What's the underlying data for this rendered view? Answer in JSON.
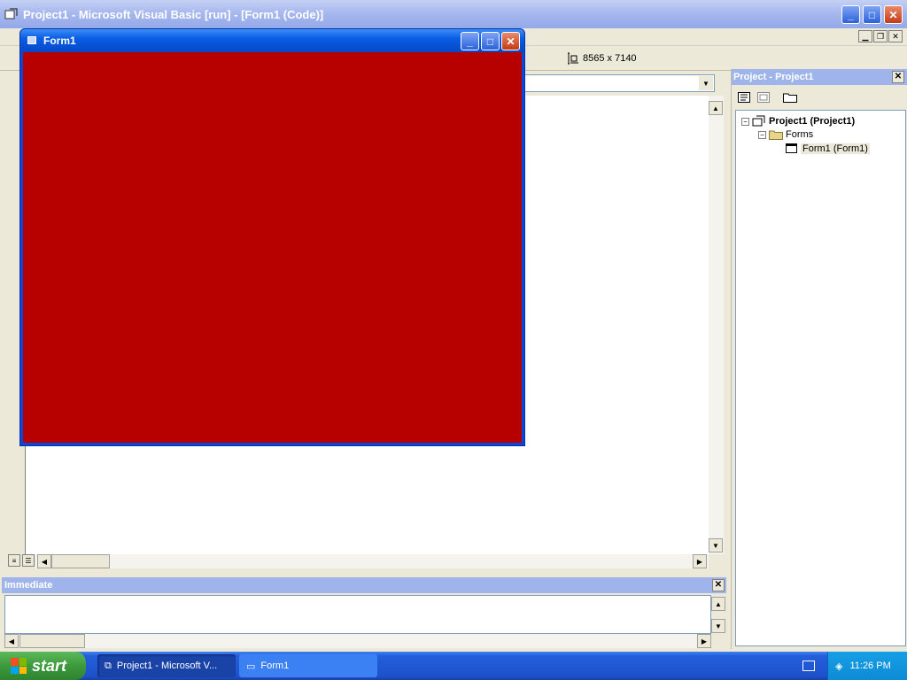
{
  "main_window": {
    "title": "Project1 - Microsoft Visual Basic [run] - [Form1 (Code)]",
    "minimize": "_",
    "maximize": "□",
    "close": "✕"
  },
  "toolbar": {
    "size_readout": "8565 x 7140"
  },
  "form_window": {
    "title": "Form1",
    "minimize": "_",
    "maximize": "□",
    "close": "✕",
    "client_color": "#b70000"
  },
  "project_explorer": {
    "title": "Project - Project1",
    "close": "✕",
    "tree": [
      {
        "label": "Project1 (Project1)",
        "icon": "project-icon"
      },
      {
        "label": "Forms",
        "icon": "folder-icon"
      },
      {
        "label": "Form1 (Form1)",
        "icon": "form-icon"
      }
    ]
  },
  "immediate": {
    "title": "Immediate",
    "close": "✕"
  },
  "taskbar": {
    "start_label": "start",
    "buttons": [
      {
        "label": "Project1 - Microsoft V..."
      },
      {
        "label": "Form1"
      }
    ],
    "clock": "11:26 PM"
  }
}
